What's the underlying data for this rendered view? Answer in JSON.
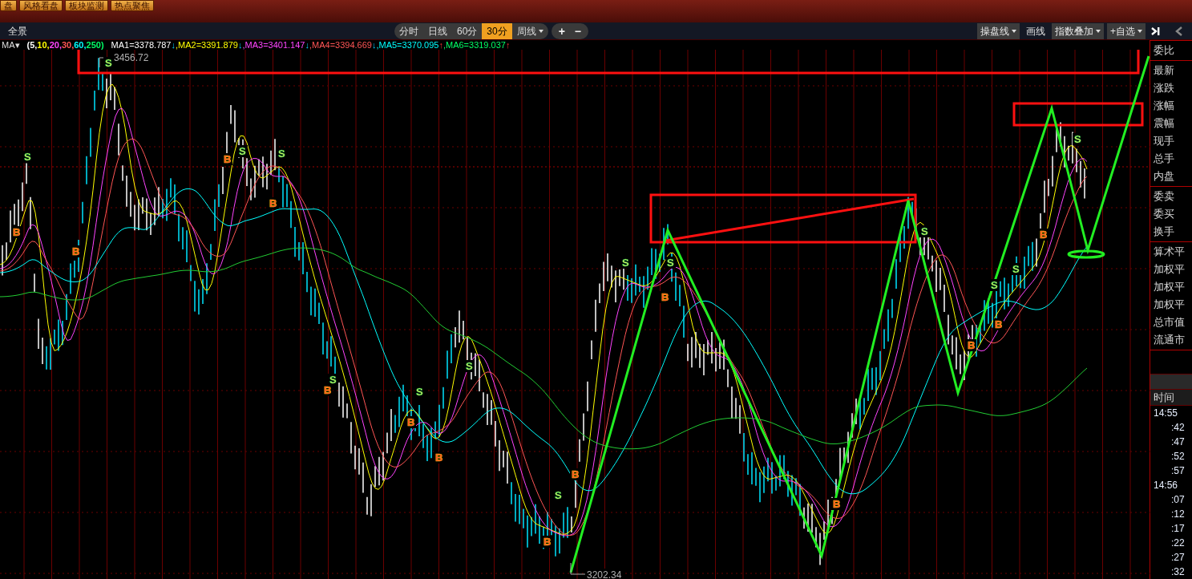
{
  "top_tabs": [
    {
      "label": "盘"
    },
    {
      "label": "风格看盘"
    },
    {
      "label": "板块监测"
    },
    {
      "label": "热点聚焦"
    }
  ],
  "toolbar": {
    "title": "全景",
    "periods": [
      {
        "label": "分时",
        "selected": false,
        "dropdown": false
      },
      {
        "label": "日线",
        "selected": false,
        "dropdown": false
      },
      {
        "label": "60分",
        "selected": false,
        "dropdown": false
      },
      {
        "label": "30分",
        "selected": true,
        "dropdown": false
      },
      {
        "label": "周线",
        "selected": false,
        "dropdown": true
      }
    ],
    "zoom_buttons": [
      "+",
      "−"
    ],
    "right_buttons": [
      {
        "label": "操盘线",
        "dropdown": true,
        "boxed": true
      },
      {
        "label": "画线",
        "dropdown": false,
        "boxed": false
      },
      {
        "label": "指数叠加",
        "dropdown": true,
        "boxed": true
      },
      {
        "label": "+自选",
        "dropdown": true,
        "boxed": true
      }
    ]
  },
  "indicator": {
    "name": "MA▾",
    "params": [
      {
        "text": "(5,",
        "color": "#ffffff"
      },
      {
        "text": "10,",
        "color": "#ffff00"
      },
      {
        "text": "20,",
        "color": "#ff44ff"
      },
      {
        "text": "30,",
        "color": "#ff5555"
      },
      {
        "text": "60,",
        "color": "#00ffff"
      },
      {
        "text": "250)",
        "color": "#00ff66"
      }
    ],
    "values": [
      {
        "text": "MA1=3378.787",
        "color": "#ffffff",
        "arrow": "↓",
        "rising": false
      },
      {
        "text": ",MA2=3391.879",
        "color": "#ffff00",
        "arrow": "↓",
        "rising": false
      },
      {
        "text": ",MA3=3401.147",
        "color": "#ff44ff",
        "arrow": "↓",
        "rising": false
      },
      {
        "text": ",MA4=3394.669",
        "color": "#ff5555",
        "arrow": "↓",
        "rising": false
      },
      {
        "text": ",MA5=3370.095",
        "color": "#00ffff",
        "arrow": "↑",
        "rising": true
      },
      {
        "text": ",MA6=3319.037",
        "color": "#00ff66",
        "arrow": "↑",
        "rising": true
      }
    ]
  },
  "price_labels": {
    "high": "3456.72",
    "low": "3202.34"
  },
  "signals": [
    {
      "label": "S",
      "kind": "sell"
    },
    {
      "label": "S",
      "kind": "sell"
    },
    {
      "label": "S",
      "kind": "sell"
    },
    {
      "label": "S",
      "kind": "sell"
    },
    {
      "label": "S",
      "kind": "sell"
    },
    {
      "label": "S",
      "kind": "sell"
    },
    {
      "label": "S",
      "kind": "sell"
    },
    {
      "label": "S",
      "kind": "sell"
    },
    {
      "label": "S",
      "kind": "sell"
    },
    {
      "label": "S",
      "kind": "sell"
    },
    {
      "label": "S",
      "kind": "sell"
    },
    {
      "label": "S",
      "kind": "sell"
    },
    {
      "label": "S",
      "kind": "sell"
    },
    {
      "label": "S",
      "kind": "sell"
    },
    {
      "label": "B",
      "kind": "buy"
    },
    {
      "label": "B",
      "kind": "buy"
    },
    {
      "label": "B",
      "kind": "buy"
    },
    {
      "label": "B",
      "kind": "buy"
    },
    {
      "label": "B",
      "kind": "buy"
    },
    {
      "label": "B",
      "kind": "buy"
    },
    {
      "label": "B",
      "kind": "buy"
    },
    {
      "label": "B",
      "kind": "buy"
    },
    {
      "label": "B",
      "kind": "buy"
    },
    {
      "label": "B",
      "kind": "buy"
    },
    {
      "label": "B",
      "kind": "buy"
    },
    {
      "label": "B",
      "kind": "buy"
    },
    {
      "label": "B",
      "kind": "buy"
    },
    {
      "label": "B",
      "kind": "buy"
    }
  ],
  "quote_panel": {
    "groups": [
      [
        "委比"
      ],
      [
        "最新",
        "涨跌",
        "涨幅",
        "震幅",
        "现手",
        "总手",
        "内盘"
      ],
      [
        "委卖",
        "委买",
        "换手"
      ],
      [
        "算术平",
        "加权平",
        "加权平",
        "加权平",
        "总市值",
        "流通市"
      ]
    ]
  },
  "ticks": {
    "header": "时间",
    "rows": [
      "14:55",
      ":42",
      ":47",
      ":52",
      ":57",
      "14:56",
      ":07",
      ":12",
      ":17",
      ":22",
      ":27",
      ":32"
    ]
  }
}
